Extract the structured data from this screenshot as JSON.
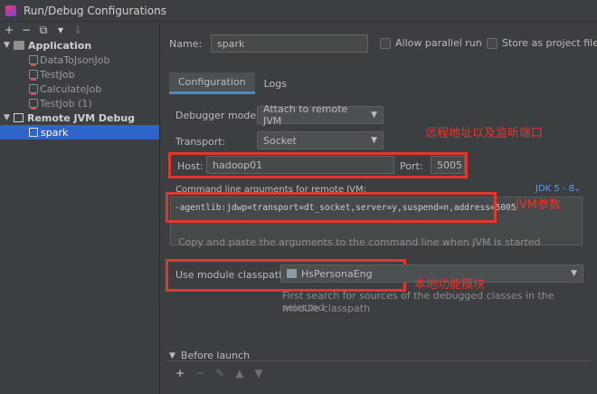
{
  "window": {
    "title": "Run/Debug Configurations"
  },
  "sidebar": {
    "toolbar": [
      "+",
      "−",
      "⧉",
      "▾",
      "↓"
    ],
    "groups": [
      {
        "label": "Application",
        "children": [
          "DataToJsonJob",
          "TestJob",
          "CalculateJob",
          "TestJob (1)"
        ]
      },
      {
        "label": "Remote JVM Debug",
        "children": [
          "spark"
        ]
      }
    ]
  },
  "header": {
    "name_label": "Name:",
    "name_value": "spark",
    "allow_parallel_label": "Allow parallel run",
    "store_project_label": "Store as project file"
  },
  "tabs": [
    {
      "label": "Configuration",
      "active": true
    },
    {
      "label": "Logs",
      "active": false
    }
  ],
  "config": {
    "debugger_mode_label": "Debugger mode:",
    "debugger_mode_value": "Attach to remote JVM",
    "transport_label": "Transport:",
    "transport_value": "Socket",
    "host_label": "Host:",
    "host_value": "hadoop01",
    "port_label": "Port:",
    "port_value": "5005",
    "cmd_label": "Command line arguments for remote JVM:",
    "jdk_label": "JDK 5 - 8",
    "cmd_value": "-agentlib:jdwp=transport=dt_socket,server=y,suspend=n,address=5005",
    "cmd_hint": "Copy and paste the arguments to the command line when JVM is started",
    "module_label": "Use module classpath:",
    "module_value": "HsPersonaEng",
    "module_hint_line1": "First search for sources of the debugged classes in the selected",
    "module_hint_line2": "module classpath",
    "before_launch_label": "Before launch",
    "before_launch_toolbar": [
      "+",
      "−",
      "✎",
      "▲",
      "▼"
    ]
  },
  "annotations": {
    "host_port": "远程地址以及监听端口",
    "jvm_args": "JVM参数",
    "module": "本地功能模块"
  },
  "colors": {
    "annotation_red": "#e2372f",
    "selection_blue": "#2f65ca",
    "accent_blue": "#4a88c7"
  }
}
